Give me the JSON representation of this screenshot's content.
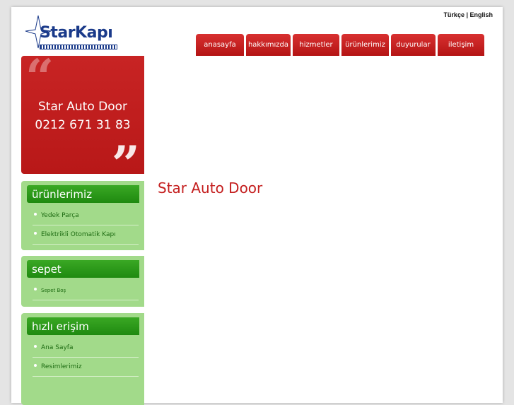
{
  "languages": [
    "Türkçe",
    "English"
  ],
  "language_separator": " | ",
  "logo": {
    "text": "StarKapı"
  },
  "nav": [
    {
      "label": "anasayfa"
    },
    {
      "label": "hakkımızda"
    },
    {
      "label": "hizmetler"
    },
    {
      "label": "ürünlerimiz"
    },
    {
      "label": "duyurular"
    },
    {
      "label": "iletişim"
    }
  ],
  "quote": {
    "open_mark": "“",
    "close_mark": "”",
    "line1": "Star Auto Door",
    "line2": "0212 671 31 83"
  },
  "products": {
    "title": "ürünlerimiz",
    "items": [
      "Yedek Parça",
      "Elektrikli Otomatik Kapı"
    ]
  },
  "cart": {
    "title": "sepet",
    "items": [
      "Sepet Boş"
    ]
  },
  "quick": {
    "title": "hızlı erişim",
    "items": [
      "Ana Sayfa",
      "Resimlerimiz"
    ]
  },
  "main": {
    "title": "Star Auto Door"
  },
  "colors": {
    "brand_red": "#c41e1e",
    "brand_blue": "#1a3a8a",
    "panel_green": "#a2da8a",
    "header_green": "#2a9a18"
  }
}
